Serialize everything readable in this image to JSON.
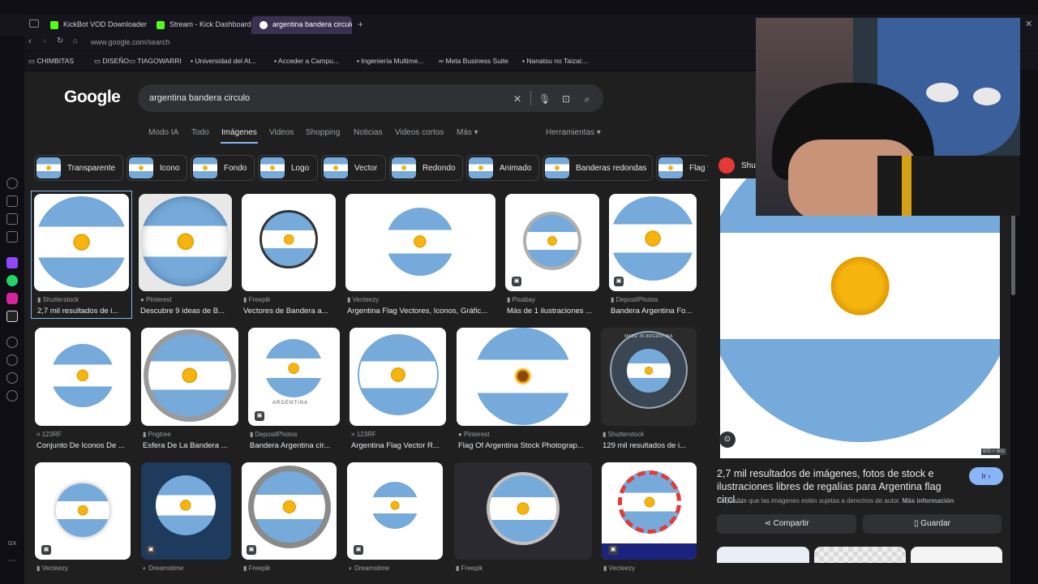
{
  "browser": {
    "tabs": [
      {
        "label": "KickBot VOD Downloader"
      },
      {
        "label": "Stream - Kick Dashboard"
      },
      {
        "label": "argentina bandera circulo"
      }
    ],
    "url": "www.google.com/search",
    "bookmarks": [
      "CHIMBITAS",
      "DISEÑO",
      "TIAGOWARRI",
      "Universidad del At...",
      "Acceder a Campu...",
      "Ingeniería Multime...",
      "Meta Business Suite",
      "Nanatsu no Taizai:..."
    ],
    "corner_label": "GX"
  },
  "google": {
    "logo": "Google",
    "query": "argentina bandera circulo",
    "nav": [
      "Modo IA",
      "Todo",
      "Imágenes",
      "Videos",
      "Shopping",
      "Noticias",
      "Videos cortos",
      "Más ▾"
    ],
    "tools": "Herramientas ▾",
    "chips": [
      "Transparente",
      "Icono",
      "Fondo",
      "Logo",
      "Vector",
      "Redondo",
      "Animado",
      "Banderas redondas",
      "Flag v"
    ]
  },
  "results": [
    {
      "source": "Shutterstock",
      "title": "2,7 mil resultados de i..."
    },
    {
      "source": "Pinterest",
      "title": "Descubre 9 ideas de B..."
    },
    {
      "source": "Freepik",
      "title": "Vectores de Bandera a..."
    },
    {
      "source": "Vecteezy",
      "title": "Argentina Flag Vectores, Iconos, Gráfic..."
    },
    {
      "source": "Pixabay",
      "title": "Más de 1 ilustraciones ..."
    },
    {
      "source": "DepositPhotos",
      "title": "Bandera Argentina Fo..."
    },
    {
      "source": "123RF",
      "title": "Conjunto De Iconos De ..."
    },
    {
      "source": "Pngtree",
      "title": "Esfera De La Bandera ..."
    },
    {
      "source": "DepositPhotos",
      "title": "Bandera Argentina cír..."
    },
    {
      "source": "123RF",
      "title": "Argentina Flag Vector R..."
    },
    {
      "source": "Pinterest",
      "title": "Flag Of Argentina Stock Photograp..."
    },
    {
      "source": "Shutterstock",
      "title": "129 mil resultados de i..."
    },
    {
      "source": "Vecteezy",
      "title": ""
    },
    {
      "source": "Dreamstime",
      "title": ""
    },
    {
      "source": "Freepik",
      "title": ""
    },
    {
      "source": "Dreamstime",
      "title": ""
    },
    {
      "source": "Freepik",
      "title": ""
    },
    {
      "source": "Vecteezy",
      "title": ""
    }
  ],
  "preview": {
    "source": "Shu",
    "dimensions": "600 × 600",
    "title": "2,7 mil resultados de imágenes, fotos de stock e ilustraciones libres de regalías para Argentina flag circl...",
    "note_prefix": "Es posible que las imágenes estén sujetas a derechos de autor.",
    "note_link": "Más información",
    "go_label": "Ir ›",
    "share_label": "Compartir",
    "save_label": "Guardar"
  },
  "badges": {
    "made_in": "MADE IN ARGENTINA",
    "argentina": "ARGENTINA"
  },
  "colors": {
    "flag_blue": "#75aadb",
    "flag_sun": "#f6b40e",
    "accent": "#8ab4f8"
  }
}
